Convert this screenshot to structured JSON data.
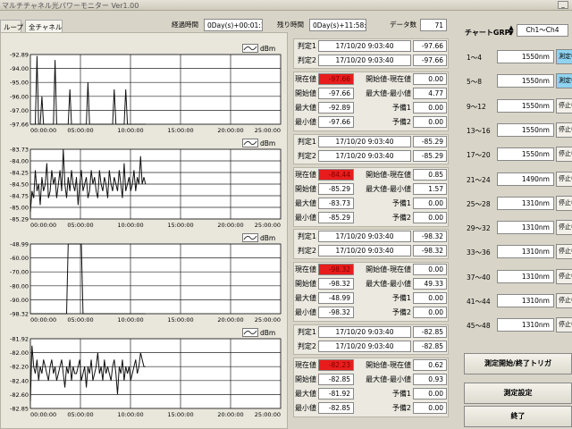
{
  "window": {
    "title": "マルチチャネル光パワーモニター Ver1.00",
    "min_label": "_"
  },
  "tabs": [
    "ループ",
    "全チャネル"
  ],
  "header": {
    "elapsed_label": "経過時間",
    "elapsed_value": "0Day(s)+00:01:10",
    "remaining_label": "残り時間",
    "remaining_value": "0Day(s)+11:58:50",
    "count_label": "データ数",
    "count_value": "71"
  },
  "charts": [
    {
      "unit": "dBm",
      "yticks": [
        "-92.89",
        "-94.00",
        "-95.00",
        "-96.00",
        "-97.00",
        "-97.66"
      ],
      "xticks": [
        "00:00:00",
        "05:00:00",
        "10:00:00",
        "15:00:00",
        "20:00:00",
        "25:00:00"
      ]
    },
    {
      "unit": "dBm",
      "yticks": [
        "-83.73",
        "-84.00",
        "-84.25",
        "-84.50",
        "-84.75",
        "-85.00",
        "-85.29"
      ],
      "xticks": [
        "00:00:00",
        "05:00:00",
        "10:00:00",
        "15:00:00",
        "20:00:00",
        "25:00:00"
      ]
    },
    {
      "unit": "dBm",
      "yticks": [
        "-48.99",
        "-60.00",
        "-70.00",
        "-80.00",
        "-90.00",
        "-98.32"
      ],
      "xticks": [
        "00:00:00",
        "05:00:00",
        "10:00:00",
        "15:00:00",
        "20:00:00",
        "25:00:00"
      ]
    },
    {
      "unit": "dBm",
      "yticks": [
        "-81.92",
        "-82.00",
        "-82.20",
        "-82.40",
        "-82.60",
        "-82.85"
      ],
      "xticks": [
        "00:00:00",
        "05:00:00",
        "10:00:00",
        "15:00:00",
        "20:00:00",
        "25:00:00"
      ]
    }
  ],
  "labels": {
    "judge1": "判定1",
    "judge2": "判定2",
    "current": "現在値",
    "start": "開始値",
    "max": "最大値",
    "min": "最小値",
    "diff_start": "開始値-現在値",
    "diff_maxmin": "最大値-最小値",
    "pred1": "予備1",
    "pred2": "予備2"
  },
  "groups": [
    {
      "judge1_time": "17/10/20 9:03:40",
      "judge1_val": "-97.66",
      "judge2_time": "17/10/20 9:03:40",
      "judge2_val": "-97.66",
      "current": "-97.66",
      "start": "-97.66",
      "max": "-92.89",
      "min": "-97.66",
      "diff_start": "0.00",
      "diff_maxmin": "4.77",
      "pred1": "0.00",
      "pred2": "0.00"
    },
    {
      "judge1_time": "17/10/20 9:03:40",
      "judge1_val": "-85.29",
      "judge2_time": "17/10/20 9:03:40",
      "judge2_val": "-85.29",
      "current": "-84.44",
      "start": "-85.29",
      "max": "-83.73",
      "min": "-85.29",
      "diff_start": "0.85",
      "diff_maxmin": "1.57",
      "pred1": "0.00",
      "pred2": "0.00"
    },
    {
      "judge1_time": "17/10/20 9:03:40",
      "judge1_val": "-98.32",
      "judge2_time": "17/10/20 9:03:40",
      "judge2_val": "-98.32",
      "current": "-98.32",
      "start": "-98.32",
      "max": "-48.99",
      "min": "-98.32",
      "diff_start": "0.00",
      "diff_maxmin": "49.33",
      "pred1": "0.00",
      "pred2": "0.00"
    },
    {
      "judge1_time": "17/10/20 9:03:40",
      "judge1_val": "-82.85",
      "judge2_time": "17/10/20 9:03:40",
      "judge2_val": "-82.85",
      "current": "-82.23",
      "start": "-82.85",
      "max": "-81.92",
      "min": "-82.85",
      "diff_start": "0.62",
      "diff_maxmin": "0.93",
      "pred1": "0.00",
      "pred2": "0.00"
    }
  ],
  "sidebar": {
    "grp_label": "チャートGRP.",
    "grp_value": "Ch1〜Ch4",
    "channels": [
      {
        "range": "1〜4",
        "wl": "1550nm",
        "state": "測定中"
      },
      {
        "range": "5〜8",
        "wl": "1550nm",
        "state": "測定中"
      },
      {
        "range": "9〜12",
        "wl": "1550nm",
        "state": "停止中"
      },
      {
        "range": "13〜16",
        "wl": "1550nm",
        "state": "停止中"
      },
      {
        "range": "17〜20",
        "wl": "1550nm",
        "state": "停止中"
      },
      {
        "range": "21〜24",
        "wl": "1490nm",
        "state": "停止中"
      },
      {
        "range": "25〜28",
        "wl": "1310nm",
        "state": "停止中"
      },
      {
        "range": "29〜32",
        "wl": "1310nm",
        "state": "停止中"
      },
      {
        "range": "33〜36",
        "wl": "1310nm",
        "state": "停止中"
      },
      {
        "range": "37〜40",
        "wl": "1310nm",
        "state": "停止中"
      },
      {
        "range": "41〜44",
        "wl": "1310nm",
        "state": "停止中"
      },
      {
        "range": "45〜48",
        "wl": "1310nm",
        "state": "停止中"
      }
    ],
    "trigger_btn": "測定開始/終了トリガ",
    "settings_btn": "測定設定",
    "exit_btn": "終了"
  },
  "colors": {
    "accent_red": "#e81c1c",
    "active_blue": "#8fd3f0"
  }
}
